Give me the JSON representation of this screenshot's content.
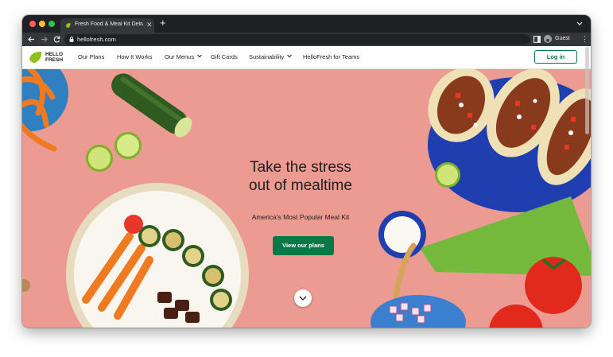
{
  "browser": {
    "tab_title": "Fresh Food & Meal Kit Delivery",
    "url": "hellofresh.com",
    "profile_label": "Guest"
  },
  "site": {
    "logo_text": "HELLO FRESH",
    "nav": [
      {
        "label": "Our Plans"
      },
      {
        "label": "How It Works"
      },
      {
        "label": "Our Menus"
      },
      {
        "label": "Gift Cards"
      },
      {
        "label": "Sustainability"
      },
      {
        "label": "HelloFresh for Teams"
      }
    ],
    "login_label": "Log in"
  },
  "hero": {
    "title_line1": "Take the stress",
    "title_line2": "out of mealtime",
    "subtitle": "America's Most Popular Meal Kit",
    "cta_label": "View our plans"
  },
  "colors": {
    "brand_green": "#067a46",
    "logo_green": "#91c11e",
    "hero_bg": "#eb9b92"
  },
  "icons": [
    "favicon-icon",
    "close-icon",
    "plus-icon",
    "back-arrow-icon",
    "forward-arrow-icon",
    "reload-icon",
    "lock-icon",
    "side-panel-icon",
    "profile-icon",
    "kebab-menu-icon",
    "chevron-down-icon"
  ]
}
